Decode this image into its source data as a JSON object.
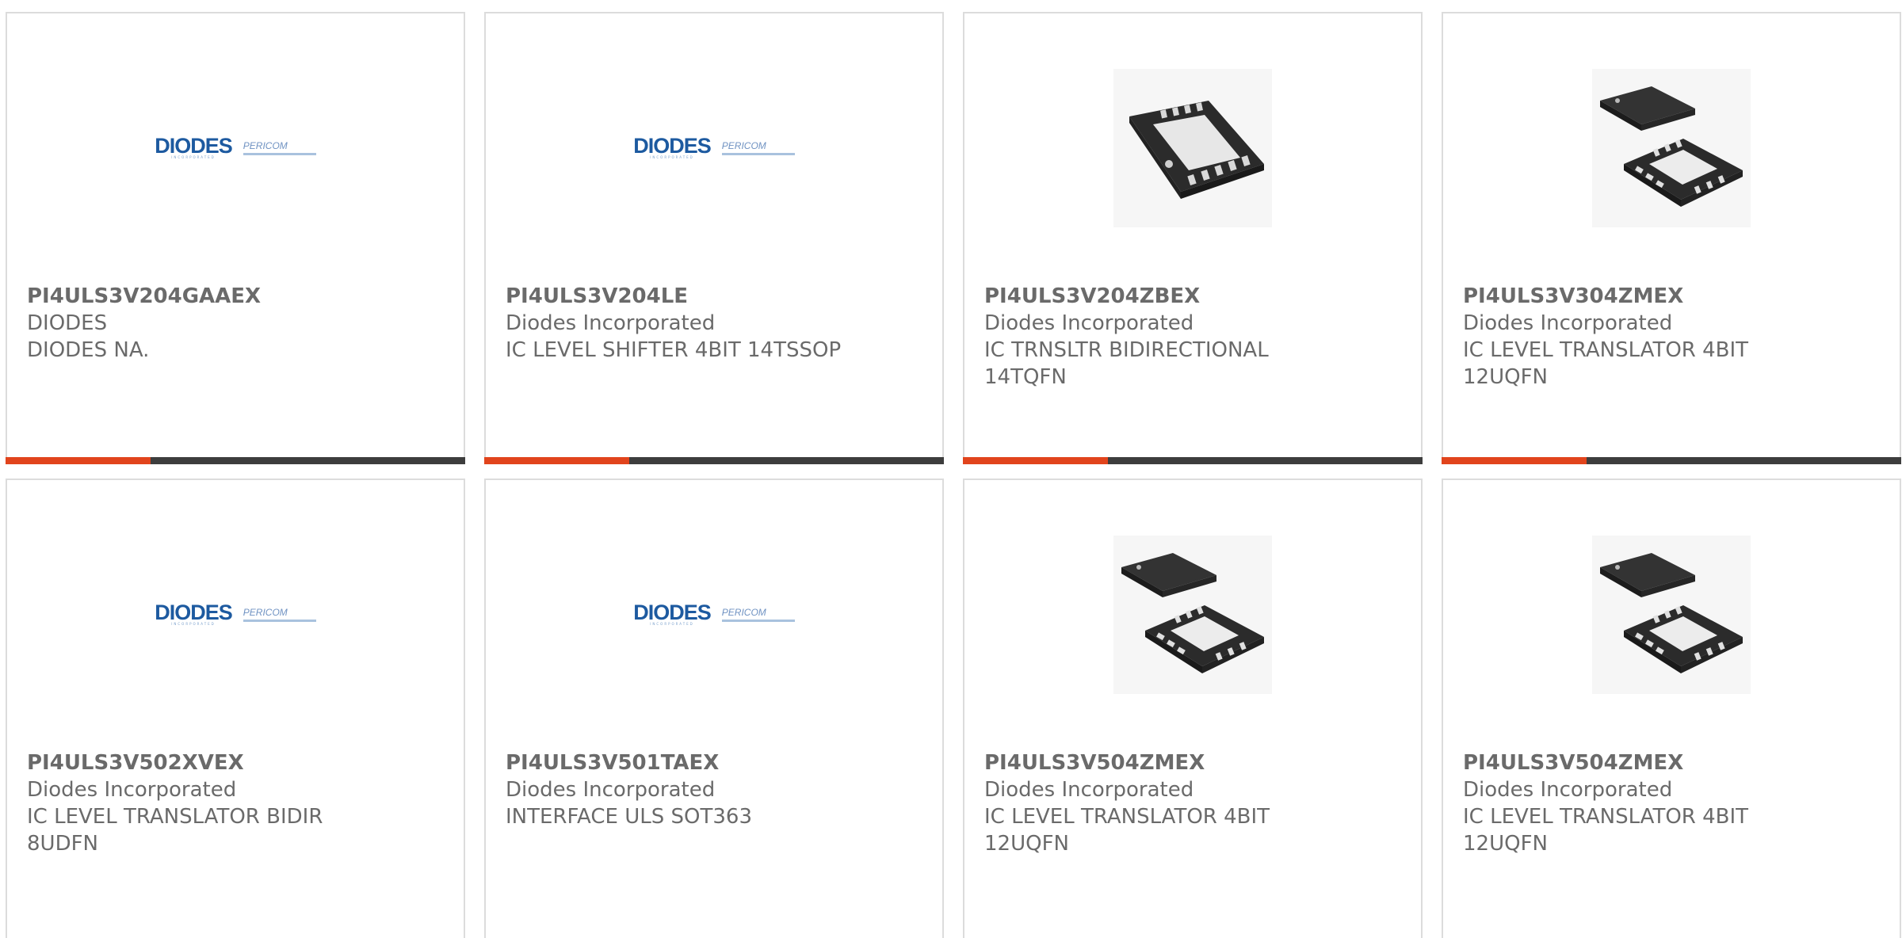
{
  "logo": {
    "word": "DIODES",
    "sub": "INCORPORATED",
    "peri": "PERICOM"
  },
  "colors": {
    "accent": "#e1441c",
    "bar": "#3d3d3d",
    "text": "#6a6a6a",
    "border": "#dcdcdc"
  },
  "products": [
    {
      "part": "PI4ULS3V204GAAEX",
      "manufacturer": "DIODES",
      "desc1": "DIODES NA.",
      "desc2": "",
      "image": "diodes-logo"
    },
    {
      "part": "PI4ULS3V204LE",
      "manufacturer": "Diodes Incorporated",
      "desc1": "IC LEVEL SHIFTER 4BIT 14TSSOP",
      "desc2": "",
      "image": "diodes-logo"
    },
    {
      "part": "PI4ULS3V204ZBEX",
      "manufacturer": "Diodes Incorporated",
      "desc1": "IC TRNSLTR BIDIRECTIONAL",
      "desc2": "14TQFN",
      "image": "qfn-chip"
    },
    {
      "part": "PI4ULS3V304ZMEX",
      "manufacturer": "Diodes Incorporated",
      "desc1": "IC LEVEL TRANSLATOR 4BIT",
      "desc2": "12UQFN",
      "image": "qfn-chip-pair"
    },
    {
      "part": "PI4ULS3V502XVEX",
      "manufacturer": "Diodes Incorporated",
      "desc1": "IC LEVEL TRANSLATOR BIDIR",
      "desc2": "8UDFN",
      "image": "diodes-logo"
    },
    {
      "part": "PI4ULS3V501TAEX",
      "manufacturer": "Diodes Incorporated",
      "desc1": "INTERFACE ULS SOT363",
      "desc2": "",
      "image": "diodes-logo"
    },
    {
      "part": "PI4ULS3V504ZMEX",
      "manufacturer": "Diodes Incorporated",
      "desc1": "IC LEVEL TRANSLATOR 4BIT",
      "desc2": "12UQFN",
      "image": "qfn-chip-pair"
    },
    {
      "part": "PI4ULS3V504ZMEX",
      "manufacturer": "Diodes Incorporated",
      "desc1": "IC LEVEL TRANSLATOR 4BIT",
      "desc2": "12UQFN",
      "image": "qfn-chip-pair"
    }
  ]
}
